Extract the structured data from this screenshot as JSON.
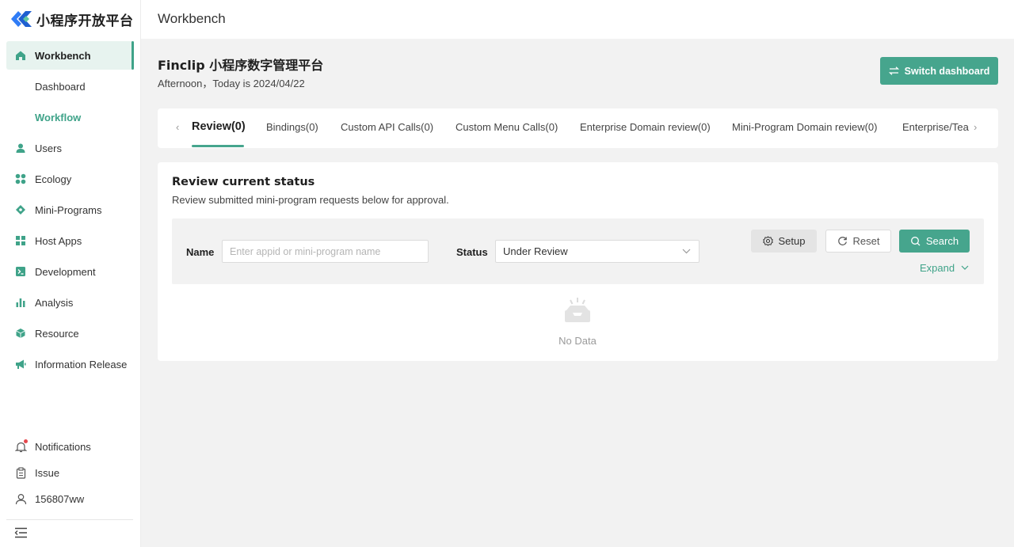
{
  "brand": {
    "name": "小程序开放平台"
  },
  "header": {
    "title": "Workbench"
  },
  "sidebar": {
    "items": [
      {
        "label": "Workbench",
        "icon": "home-icon"
      },
      {
        "label": "Dashboard"
      },
      {
        "label": "Workflow"
      },
      {
        "label": "Users",
        "icon": "user-icon"
      },
      {
        "label": "Ecology",
        "icon": "grid-icon"
      },
      {
        "label": "Mini-Programs",
        "icon": "diamond-icon"
      },
      {
        "label": "Host Apps",
        "icon": "apps-icon"
      },
      {
        "label": "Development",
        "icon": "terminal-icon"
      },
      {
        "label": "Analysis",
        "icon": "bar-chart-icon"
      },
      {
        "label": "Resource",
        "icon": "cube-icon"
      },
      {
        "label": "Information Release",
        "icon": "megaphone-icon"
      }
    ],
    "bottom": [
      {
        "label": "Notifications",
        "icon": "bell-icon"
      },
      {
        "label": "Issue",
        "icon": "clipboard-icon"
      },
      {
        "label": "156807ww",
        "icon": "user-outline-icon"
      }
    ]
  },
  "main": {
    "title": "Finclip 小程序数字管理平台",
    "greeting": "Afternoon，Today is 2024/04/22",
    "switch_label": "Switch dashboard",
    "tabs": [
      {
        "label": "Review(0)"
      },
      {
        "label": "Bindings(0)"
      },
      {
        "label": "Custom API Calls(0)"
      },
      {
        "label": "Custom Menu Calls(0)"
      },
      {
        "label": "Enterprise Domain review(0)"
      },
      {
        "label": "Mini-Program Domain review(0)"
      },
      {
        "label": "Enterprise/Tea"
      }
    ],
    "card": {
      "title": "Review current status",
      "subtitle": "Review submitted mini-program requests below for approval.",
      "filter": {
        "name_label": "Name",
        "name_placeholder": "Enter appid or mini-program name",
        "name_value": "",
        "status_label": "Status",
        "status_value": "Under Review",
        "setup_label": "Setup",
        "reset_label": "Reset",
        "search_label": "Search",
        "expand_label": "Expand"
      },
      "empty_text": "No Data"
    }
  },
  "colors": {
    "accent": "#46a58d",
    "active_bg": "#e7f3ef",
    "notification_dot": "#e5484d",
    "logo_blue": "#2f7cf6"
  }
}
